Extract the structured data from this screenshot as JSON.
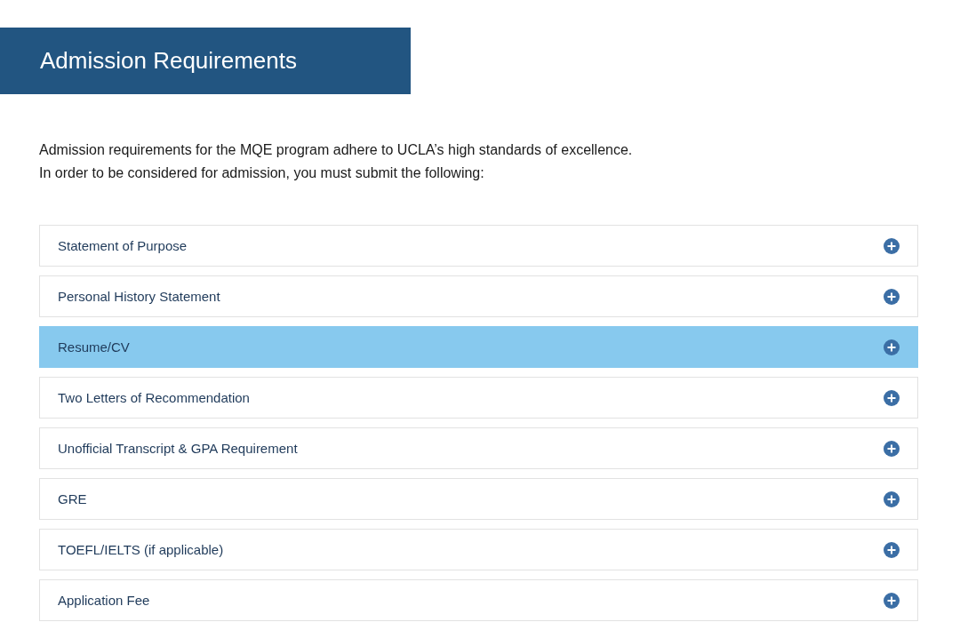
{
  "header": {
    "title": "Admission Requirements"
  },
  "intro": [
    "Admission requirements for the MQE program adhere to UCLA’s high standards of excellence.",
    "In order to be considered for admission, you must submit the following:"
  ],
  "accordion": [
    {
      "label": "Statement of Purpose",
      "selected": false
    },
    {
      "label": "Personal History Statement",
      "selected": false
    },
    {
      "label": "Resume/CV",
      "selected": true
    },
    {
      "label": "Two Letters of Recommendation",
      "selected": false
    },
    {
      "label": "Unofficial Transcript & GPA Requirement",
      "selected": false
    },
    {
      "label": "GRE",
      "selected": false
    },
    {
      "label": "TOEFL/IELTS (if applicable)",
      "selected": false
    },
    {
      "label": "Application Fee",
      "selected": false
    }
  ]
}
